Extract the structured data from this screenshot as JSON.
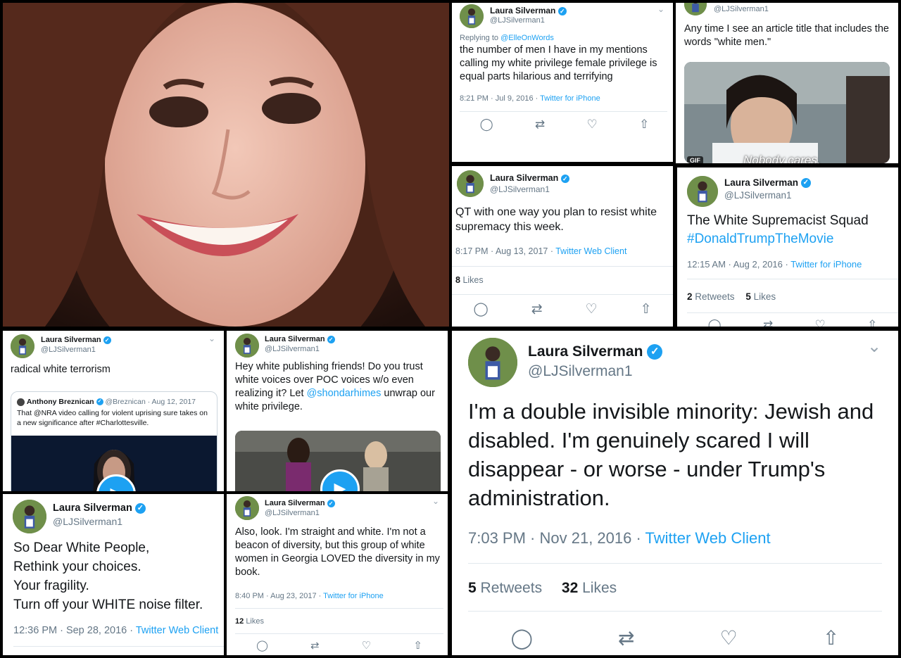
{
  "colors": {
    "link": "#1da1f2",
    "muted": "#657786",
    "border": "#e1e8ed"
  },
  "author": {
    "name": "Laura Silverman",
    "handle": "@LJSilverman1"
  },
  "t1": {
    "replying_prefix": "Replying to",
    "replying_to": "@ElleOnWords",
    "text": "the number of men I have in my mentions calling my white privilege female privilege is equal parts hilarious and terrifying",
    "time": "8:21 PM · Jul 9, 2016 · ",
    "source": "Twitter for iPhone"
  },
  "t2": {
    "text": "Any time I see an article title that includes the words \"white men.\"",
    "gif_badge": "GIF",
    "caption": "Nobody cares."
  },
  "t3": {
    "text": "QT with one way you plan to resist white supremacy this week.",
    "time": "8:17 PM · Aug 13, 2017 · ",
    "source": "Twitter Web Client",
    "likes_count": "8",
    "likes_label": "Likes"
  },
  "t4": {
    "text": "The White Supremacist Squad",
    "hashtag": "#DonaldTrumpTheMovie",
    "time": "12:15 AM · Aug 2, 2016 · ",
    "source": "Twitter for iPhone",
    "retweets_count": "2",
    "retweets_label": "Retweets",
    "likes_count": "5",
    "likes_label": "Likes"
  },
  "t5": {
    "text": "radical white terrorism",
    "quoted_name": "Anthony Breznican",
    "quoted_handle": "@Breznican · Aug 12, 2017",
    "quoted_text": "That @NRA video calling for violent uprising sure takes on a new significance after #Charlottesville."
  },
  "t6": {
    "text": "Hey white publishing friends! Do you trust white voices over POC voices w/o even realizing it? Let ",
    "mention": "@shondarhimes",
    "text_after": " unwrap our white privilege."
  },
  "t7": {
    "lines": [
      "So Dear White People,",
      "Rethink your choices.",
      "Your fragility.",
      "Turn off your WHITE noise filter."
    ],
    "time": "12:36 PM · Sep 28, 2016 · ",
    "source": "Twitter Web Client"
  },
  "t8": {
    "text": "Also, look. I'm straight and white. I'm not a beacon of diversity, but this group of white women in Georgia LOVED the diversity in my book.",
    "time": "8:40 PM · Aug 23, 2017 · ",
    "source": "Twitter for iPhone",
    "likes_count": "12",
    "likes_label": "Likes"
  },
  "t9": {
    "text": "I'm a double invisible minority: Jewish and disabled. I'm genuinely scared I will disappear - or worse - under Trump's administration.",
    "time": "7:03 PM · Nov 21, 2016 · ",
    "source": "Twitter Web Client",
    "retweets_count": "5",
    "retweets_label": "Retweets",
    "likes_count": "32",
    "likes_label": "Likes"
  },
  "icons": {
    "verified": "✓",
    "reply": "reply-icon",
    "retweet": "retweet-icon",
    "like": "heart-icon",
    "share": "share-icon",
    "chevron": "chevron-down-icon",
    "play": "play-icon"
  }
}
